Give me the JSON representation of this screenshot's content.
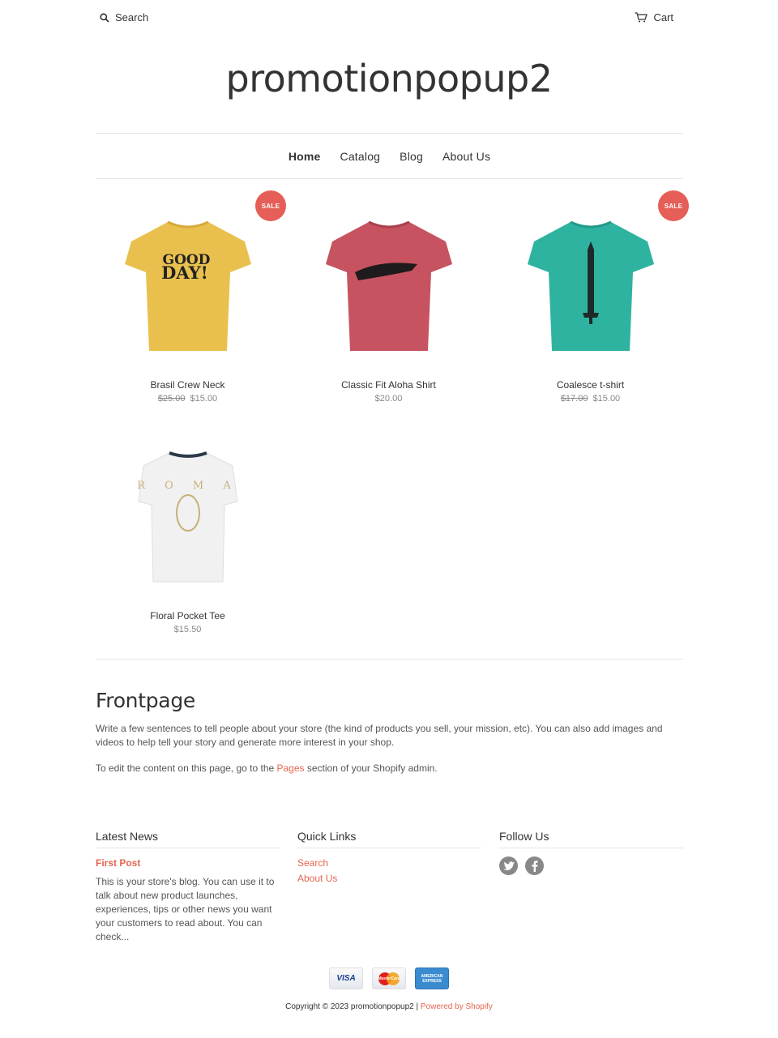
{
  "header": {
    "search_label": "Search",
    "cart_label": "Cart",
    "store_name": "promotionpopup2"
  },
  "nav": {
    "items": [
      {
        "label": "Home"
      },
      {
        "label": "Catalog"
      },
      {
        "label": "Blog"
      },
      {
        "label": "About Us"
      }
    ]
  },
  "products": [
    {
      "title": "Brasil Crew Neck",
      "compare_price": "$25.00",
      "price": "$15.00",
      "badge": "SALE",
      "shirt_color": "#e9c04e",
      "print": "GOOD DAY!"
    },
    {
      "title": "Classic Fit Aloha Shirt",
      "price": "$20.00",
      "shirt_color": "#c6535f"
    },
    {
      "title": "Coalesce t-shirt",
      "compare_price": "$17.00",
      "price": "$15.00",
      "badge": "SALE",
      "shirt_color": "#2fb3a1"
    },
    {
      "title": "Floral Pocket Tee",
      "price": "$15.50",
      "shirt_color": "#f1f1f1",
      "print": "R O M A"
    }
  ],
  "frontpage": {
    "heading": "Frontpage",
    "paragraph1": "Write a few sentences to tell people about your store (the kind of products you sell, your mission, etc). You can also add images and videos to help tell your story and generate more interest in your shop.",
    "paragraph2_before": "To edit the content on this page, go to the ",
    "paragraph2_link": "Pages",
    "paragraph2_after": " section of your Shopify admin."
  },
  "footer": {
    "latest_news": {
      "heading": "Latest News",
      "post_title": "First Post",
      "excerpt": "This is your store's blog. You can use it to talk about new product launches, experiences, tips or other news you want your customers to read about. You can check..."
    },
    "quick_links": {
      "heading": "Quick Links",
      "links": [
        {
          "label": "Search"
        },
        {
          "label": "About Us"
        }
      ]
    },
    "follow_us": {
      "heading": "Follow Us",
      "icons": [
        "twitter-icon",
        "facebook-icon"
      ]
    },
    "payments": [
      {
        "name": "VISA"
      },
      {
        "name": "MasterCard"
      },
      {
        "name": "AMERICAN EXPRESS"
      }
    ],
    "copyright_text": "Copyright © 2023 promotionpopup2 | ",
    "powered_by": "Powered by Shopify"
  },
  "colors": {
    "accent": "#e5654f",
    "sale_badge": "#e55e57"
  }
}
